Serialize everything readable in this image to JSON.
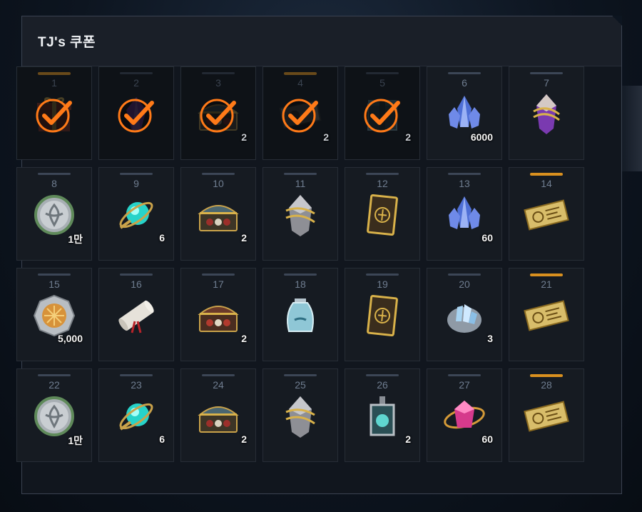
{
  "header": {
    "title": "TJ's 쿠폰"
  },
  "colors": {
    "accent_bar": "#d9901f",
    "check": "#ff7a18"
  },
  "cells": [
    {
      "day": "1",
      "icon": "gift-box-icon",
      "qty": "",
      "claimed": true,
      "highlight": true
    },
    {
      "day": "2",
      "icon": "amethyst-crystal-icon",
      "qty": "",
      "claimed": true,
      "highlight": false
    },
    {
      "day": "3",
      "icon": "treasure-chest-icon",
      "qty": "2",
      "claimed": true,
      "highlight": false
    },
    {
      "day": "4",
      "icon": "ticket-icon",
      "qty": "2",
      "claimed": true,
      "highlight": true
    },
    {
      "day": "5",
      "icon": "crate-icon",
      "qty": "2",
      "claimed": true,
      "highlight": false
    },
    {
      "day": "6",
      "icon": "blue-crystal-icon",
      "qty": "6000",
      "claimed": false,
      "highlight": false
    },
    {
      "day": "7",
      "icon": "purple-gem-icon",
      "qty": "",
      "claimed": false,
      "highlight": false
    },
    {
      "day": "8",
      "icon": "silver-coin-icon",
      "qty": "1만",
      "claimed": false,
      "highlight": false
    },
    {
      "day": "9",
      "icon": "cyan-orb-icon",
      "qty": "6",
      "claimed": false,
      "highlight": false
    },
    {
      "day": "10",
      "icon": "treasure-chest-icon",
      "qty": "2",
      "claimed": false,
      "highlight": false
    },
    {
      "day": "11",
      "icon": "gold-banded-stone-icon",
      "qty": "",
      "claimed": false,
      "highlight": false
    },
    {
      "day": "12",
      "icon": "card-icon",
      "qty": "",
      "claimed": false,
      "highlight": false
    },
    {
      "day": "13",
      "icon": "blue-crystal-icon",
      "qty": "60",
      "claimed": false,
      "highlight": false
    },
    {
      "day": "14",
      "icon": "gold-ticket-icon",
      "qty": "",
      "claimed": false,
      "highlight": true
    },
    {
      "day": "15",
      "icon": "gold-medal-icon",
      "qty": "5,000",
      "claimed": false,
      "highlight": false
    },
    {
      "day": "16",
      "icon": "scroll-icon",
      "qty": "",
      "claimed": false,
      "highlight": false
    },
    {
      "day": "17",
      "icon": "red-chest-icon",
      "qty": "2",
      "claimed": false,
      "highlight": false
    },
    {
      "day": "18",
      "icon": "potion-jar-icon",
      "qty": "",
      "claimed": false,
      "highlight": false
    },
    {
      "day": "19",
      "icon": "card-icon",
      "qty": "",
      "claimed": false,
      "highlight": false
    },
    {
      "day": "20",
      "icon": "crystal-ore-icon",
      "qty": "3",
      "claimed": false,
      "highlight": false
    },
    {
      "day": "21",
      "icon": "gold-ticket-icon",
      "qty": "",
      "claimed": false,
      "highlight": true
    },
    {
      "day": "22",
      "icon": "silver-coin-icon",
      "qty": "1만",
      "claimed": false,
      "highlight": false
    },
    {
      "day": "23",
      "icon": "cyan-orb-icon",
      "qty": "6",
      "claimed": false,
      "highlight": false
    },
    {
      "day": "24",
      "icon": "treasure-chest-icon",
      "qty": "2",
      "claimed": false,
      "highlight": false
    },
    {
      "day": "25",
      "icon": "gold-banded-stone-icon",
      "qty": "",
      "claimed": false,
      "highlight": false
    },
    {
      "day": "26",
      "icon": "potion-bottle-icon",
      "qty": "2",
      "claimed": false,
      "highlight": false
    },
    {
      "day": "27",
      "icon": "pink-gem-icon",
      "qty": "60",
      "claimed": false,
      "highlight": false
    },
    {
      "day": "28",
      "icon": "gold-ticket-icon",
      "qty": "",
      "claimed": false,
      "highlight": true
    }
  ]
}
